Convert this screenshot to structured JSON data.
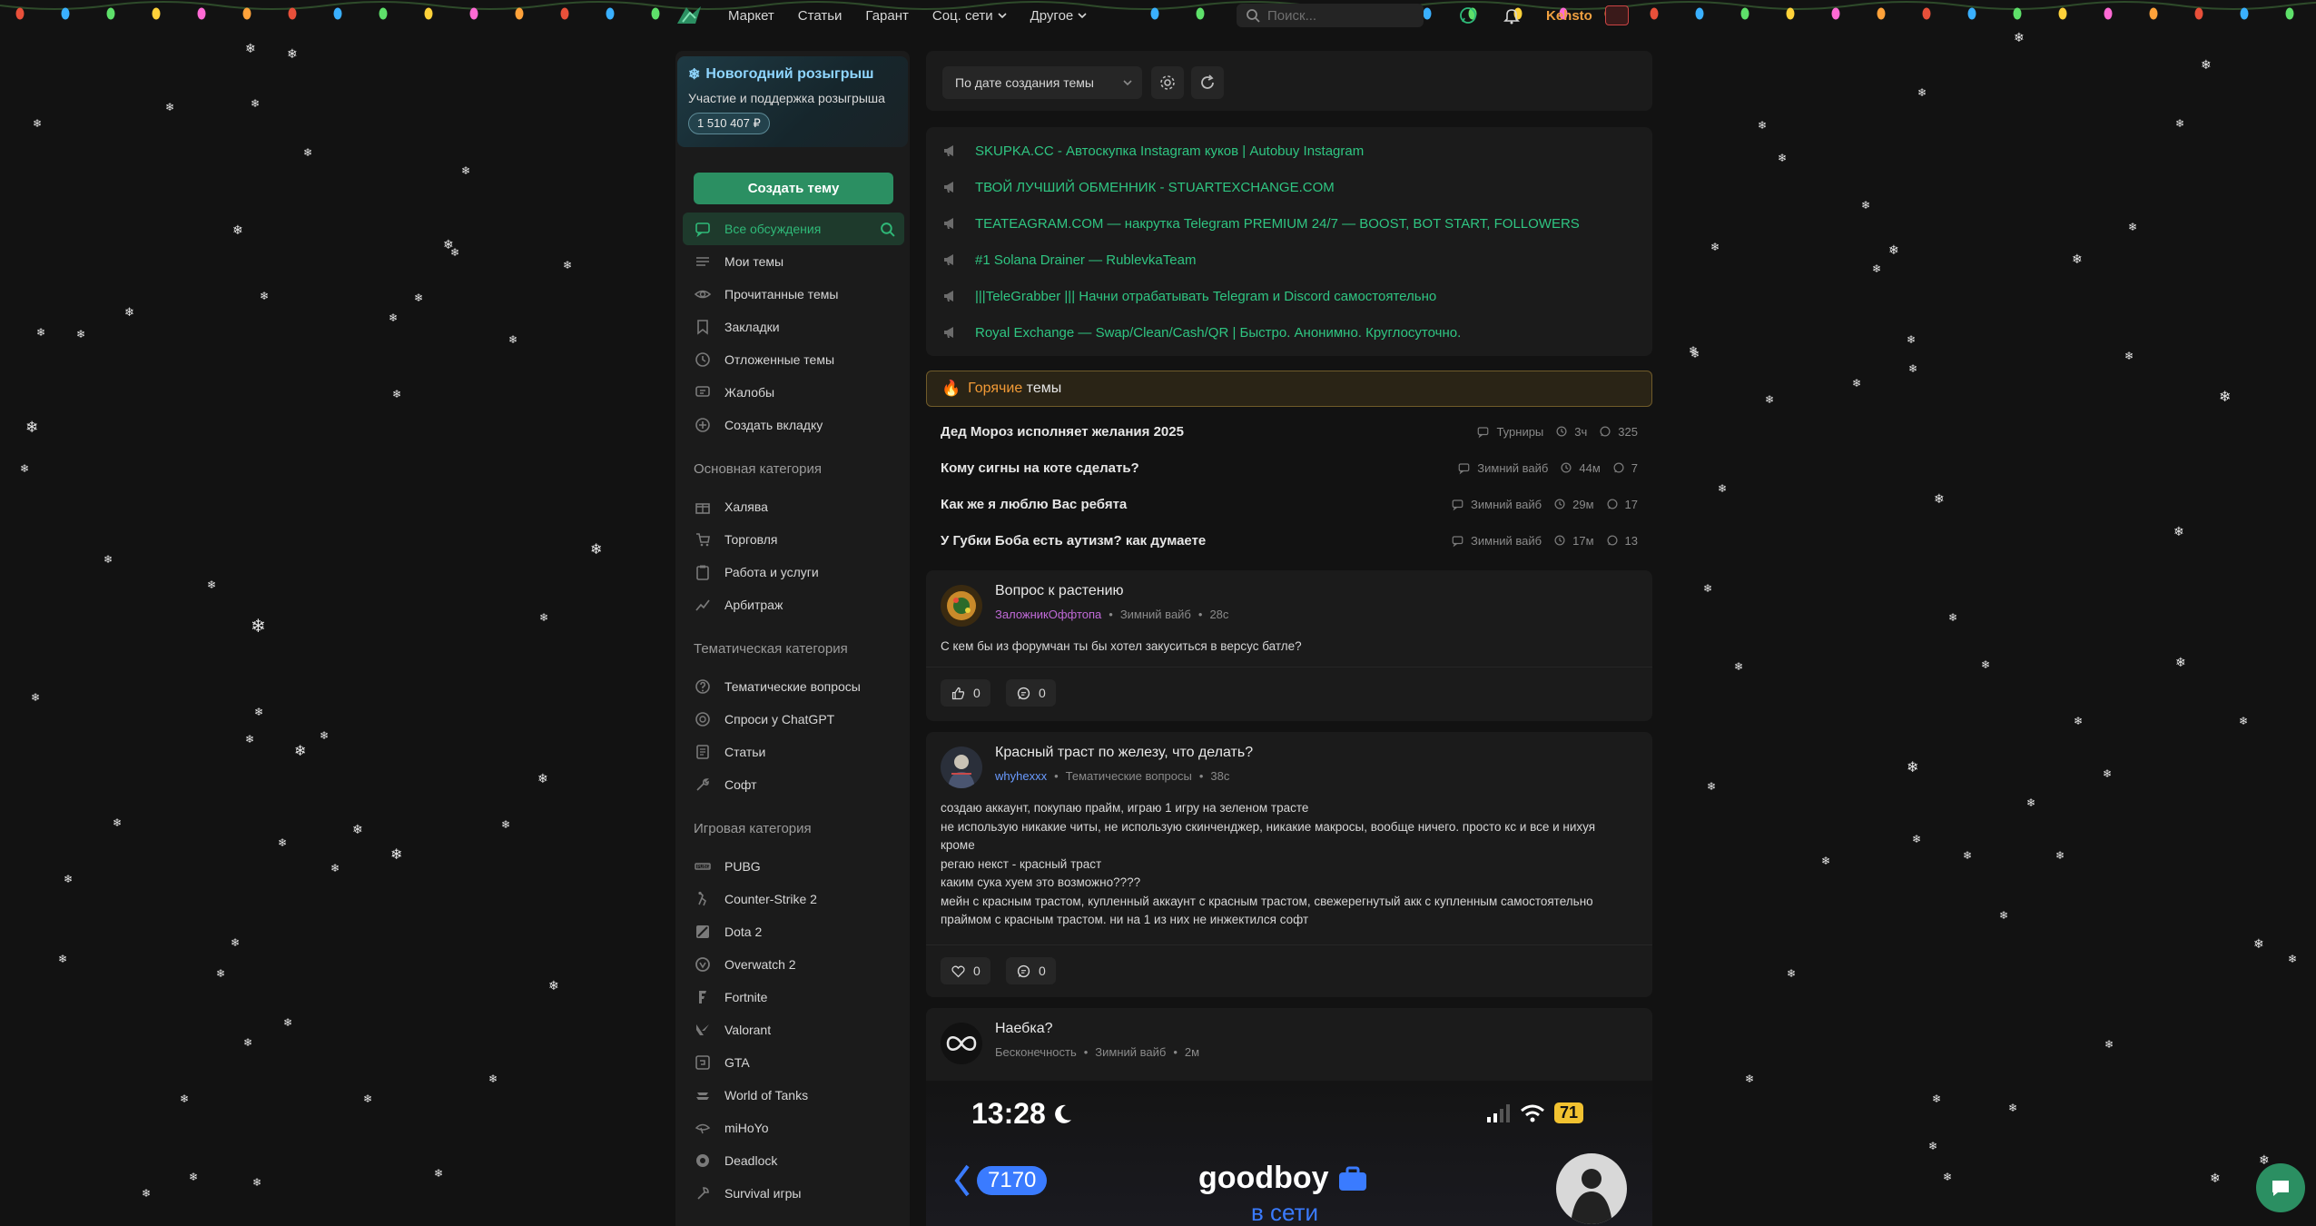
{
  "header": {
    "nav": [
      {
        "label": "Маркет",
        "dropdown": false
      },
      {
        "label": "Статьи",
        "dropdown": false
      },
      {
        "label": "Гарант",
        "dropdown": false
      },
      {
        "label": "Соц. сети",
        "dropdown": true
      },
      {
        "label": "Другое",
        "dropdown": true
      }
    ],
    "search_placeholder": "Поиск...",
    "username": "Kehsto"
  },
  "sidebar": {
    "giveaway": {
      "title": "Новогодний розыгрыш",
      "subtitle": "Участие и поддержка розыгрыша",
      "amount": "1 510 407 ₽"
    },
    "create_button": "Создать тему",
    "main_items": [
      {
        "label": "Все обсуждения",
        "icon": "chat-icon",
        "active": true
      },
      {
        "label": "Мои темы",
        "icon": "list-icon"
      },
      {
        "label": "Прочитанные темы",
        "icon": "eye-icon"
      },
      {
        "label": "Закладки",
        "icon": "bookmark-icon"
      },
      {
        "label": "Отложенные темы",
        "icon": "clock-icon"
      },
      {
        "label": "Жалобы",
        "icon": "report-icon"
      },
      {
        "label": "Создать вкладку",
        "icon": "plus-circle-icon"
      }
    ],
    "categories": [
      {
        "title": "Основная категория",
        "items": [
          {
            "label": "Халява",
            "icon": "gift-icon"
          },
          {
            "label": "Торговля",
            "icon": "cart-icon"
          },
          {
            "label": "Работа и услуги",
            "icon": "clipboard-icon"
          },
          {
            "label": "Арбитраж",
            "icon": "chart-icon"
          }
        ]
      },
      {
        "title": "Тематическая категория",
        "items": [
          {
            "label": "Тематические вопросы",
            "icon": "question-icon"
          },
          {
            "label": "Спроси у ChatGPT",
            "icon": "ai-icon"
          },
          {
            "label": "Статьи",
            "icon": "article-icon"
          },
          {
            "label": "Софт",
            "icon": "wrench-icon"
          }
        ]
      },
      {
        "title": "Игровая категория",
        "items": [
          {
            "label": "PUBG",
            "icon": "pubg-icon"
          },
          {
            "label": "Counter-Strike 2",
            "icon": "cs2-icon"
          },
          {
            "label": "Dota 2",
            "icon": "dota-icon"
          },
          {
            "label": "Overwatch 2",
            "icon": "overwatch-icon"
          },
          {
            "label": "Fortnite",
            "icon": "fortnite-icon"
          },
          {
            "label": "Valorant",
            "icon": "valorant-icon"
          },
          {
            "label": "GTA",
            "icon": "gta-icon"
          },
          {
            "label": "World of Tanks",
            "icon": "tank-icon"
          },
          {
            "label": "miHoYo",
            "icon": "mihoyo-icon"
          },
          {
            "label": "Deadlock",
            "icon": "deadlock-icon"
          },
          {
            "label": "Survival игры",
            "icon": "axe-icon"
          }
        ]
      }
    ]
  },
  "feed": {
    "sort_label": "По дате создания темы",
    "sticky": [
      "SKUPKA.CC - Автоскупка Instagram куков | Autobuy Instagram",
      "ТВОЙ ЛУЧШИЙ ОБМЕННИК - STUARTEXCHANGE.COM",
      "TEATEAGRAM.COM — накрутка Telegram PREMIUM 24/7 — BOOST, BOT START, FOLLOWERS",
      "#1 Solana Drainer — RublevkaTeam",
      "|||TeleGrabber ||| Начни отрабатывать Telegram и Discord самостоятельно",
      "Royal Exchange — Swap/Clean/Cash/QR | Быстро. Анонимно. Круглосуточно."
    ],
    "hot": {
      "accent": "Горячие",
      "rest": "темы",
      "rows": [
        {
          "title": "Дед Мороз исполняет желания 2025",
          "section": "Турниры",
          "time": "3ч",
          "replies": "325"
        },
        {
          "title": "Кому сигны на коте сделать?",
          "section": "Зимний вайб",
          "time": "44м",
          "replies": "7"
        },
        {
          "title": "Как же я люблю Вас ребята",
          "section": "Зимний вайб",
          "time": "29м",
          "replies": "17"
        },
        {
          "title": "У Губки Боба есть аутизм? как думаете",
          "section": "Зимний вайб",
          "time": "17м",
          "replies": "13"
        }
      ]
    },
    "posts": [
      {
        "title": "Вопрос к растению",
        "author": "ЗаложникОффтопа",
        "author_color": "#c06ad8",
        "section": "Зимний вайб",
        "time": "28с",
        "body": [
          "С кем бы из форумчан ты бы хотел закуситься в версус батле?"
        ],
        "likes": "0",
        "comments": "0"
      },
      {
        "title": "Красный траст по железу, что делать?",
        "author": "whyhexxx",
        "author_color": "#6a9bff",
        "section": "Тематические вопросы",
        "time": "38с",
        "body": [
          "создаю аккаунт, покупаю прайм, играю 1 игру на зеленом трасте",
          "не использую никакие читы, не использую скинченджер, никакие макросы, вообще ничего. просто кс и все и нихуя",
          "кроме",
          "регаю некст - красный траст",
          "каким сука хуем это возможно????",
          "мейн с красным трастом, купленный аккаунт с красным трастом, свежерегнутый акк с купленным самостоятельно",
          "праймом с красным трастом. ни на 1 из них не инжектился софт"
        ],
        "likes": "0",
        "comments": "0"
      },
      {
        "title": "Наебка?",
        "author": "Бесконечность",
        "author_color": "#8a8a8a",
        "section": "Зимний вайб",
        "time": "2м",
        "screenshot": {
          "time": "13:28",
          "battery": "71",
          "badge": "7170",
          "name": "goodboy",
          "status": "в сети"
        }
      }
    ]
  },
  "colors": {
    "accent_green": "#2b8f62",
    "link_green": "#2fc582",
    "hot_orange": "#f29a36",
    "background": "#121212",
    "panel": "#1b1b1b"
  }
}
